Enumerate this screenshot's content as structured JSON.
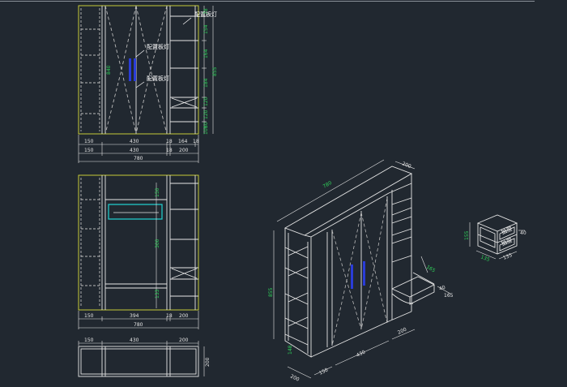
{
  "colors": {
    "background": "#212830",
    "line": "#e6e6e6",
    "frame_yellow": "#d8dc3a",
    "dimension_green": "#2fd35a",
    "handle_blue": "#2a3cd8",
    "rail_cyan": "#21c7c7"
  },
  "front_view": {
    "callouts": [
      "配置板灯",
      "配置板灯",
      "配置板灯"
    ],
    "height_dim": "840",
    "right_dims": [
      "78",
      "154",
      "164",
      "184",
      "120",
      "120",
      "50",
      "100"
    ],
    "overall_height": "855",
    "bottom_row1": [
      "150",
      "430",
      "18",
      "164",
      "18"
    ],
    "bottom_row2": [
      "150",
      "430",
      "18",
      "200"
    ],
    "overall_width": "780"
  },
  "section_view": {
    "inner_dims": [
      "150",
      "300",
      "133"
    ],
    "bottom_row": [
      "150",
      "394",
      "18",
      "200"
    ],
    "overall_width": "780"
  },
  "plan_view": {
    "top_row": [
      "150",
      "430",
      "200"
    ],
    "side_dim": "200"
  },
  "iso_view": {
    "width_top": "780",
    "depth_top": "200",
    "height": "855",
    "desk_depth": "165",
    "desk_height": "40",
    "desk_tag": "165",
    "bottom_dims": [
      "200",
      "150",
      "430",
      "200"
    ],
    "left_bottom": "148"
  },
  "drawer_cabinet": {
    "labels": [
      "抽屉",
      "抽屉"
    ],
    "height_dim": "155",
    "width_dim": "135",
    "depth_dim": "135",
    "side_dim": "40"
  }
}
